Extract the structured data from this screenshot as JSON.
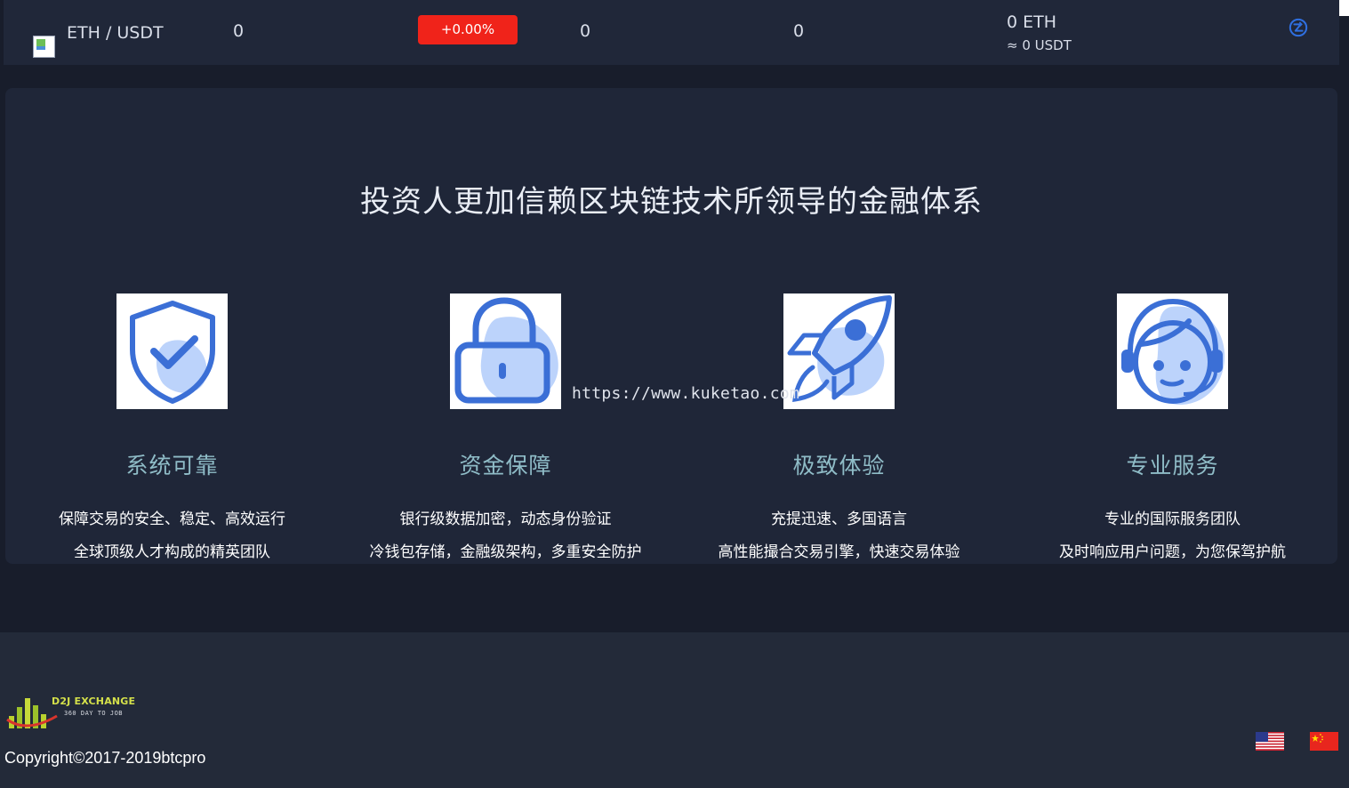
{
  "market_row": {
    "pair": "ETH / USDT",
    "price": "0",
    "change": "+0.00%",
    "high": "0",
    "low": "0",
    "volume_eth": "0 ETH",
    "volume_usdt": "≈ 0 USDT",
    "pair_icon": "broken-image-icon",
    "action_icon": "coin-exchange-icon",
    "colors": {
      "change_bg": "#f0231a",
      "accent": "#2f6fe0"
    }
  },
  "features": {
    "title": "投资人更加信赖区块链技术所领导的金融体系",
    "items": [
      {
        "icon": "shield-check-icon",
        "title": "系统可靠",
        "lines": [
          "保障交易的安全、稳定、高效运行",
          "全球顶级人才构成的精英团队"
        ]
      },
      {
        "icon": "lock-icon",
        "title": "资金保障",
        "lines": [
          "银行级数据加密，动态身份验证",
          "冷钱包存储，金融级架构，多重安全防护"
        ]
      },
      {
        "icon": "rocket-icon",
        "title": "极致体验",
        "lines": [
          "充提迅速、多国语言",
          "高性能撮合交易引擎，快速交易体验"
        ]
      },
      {
        "icon": "customer-service-icon",
        "title": "专业服务",
        "lines": [
          "专业的国际服务团队",
          "及时响应用户问题，为您保驾护航"
        ]
      }
    ]
  },
  "watermark": "https://www.kuketao.com",
  "footer": {
    "logo_name": "D2J EXCHANGE",
    "logo_tagline": "360 DAY TO JOB",
    "copyright": "Copyright©2017-2019btcpro",
    "languages": [
      {
        "icon": "us-flag-icon"
      },
      {
        "icon": "china-flag-icon"
      }
    ]
  }
}
